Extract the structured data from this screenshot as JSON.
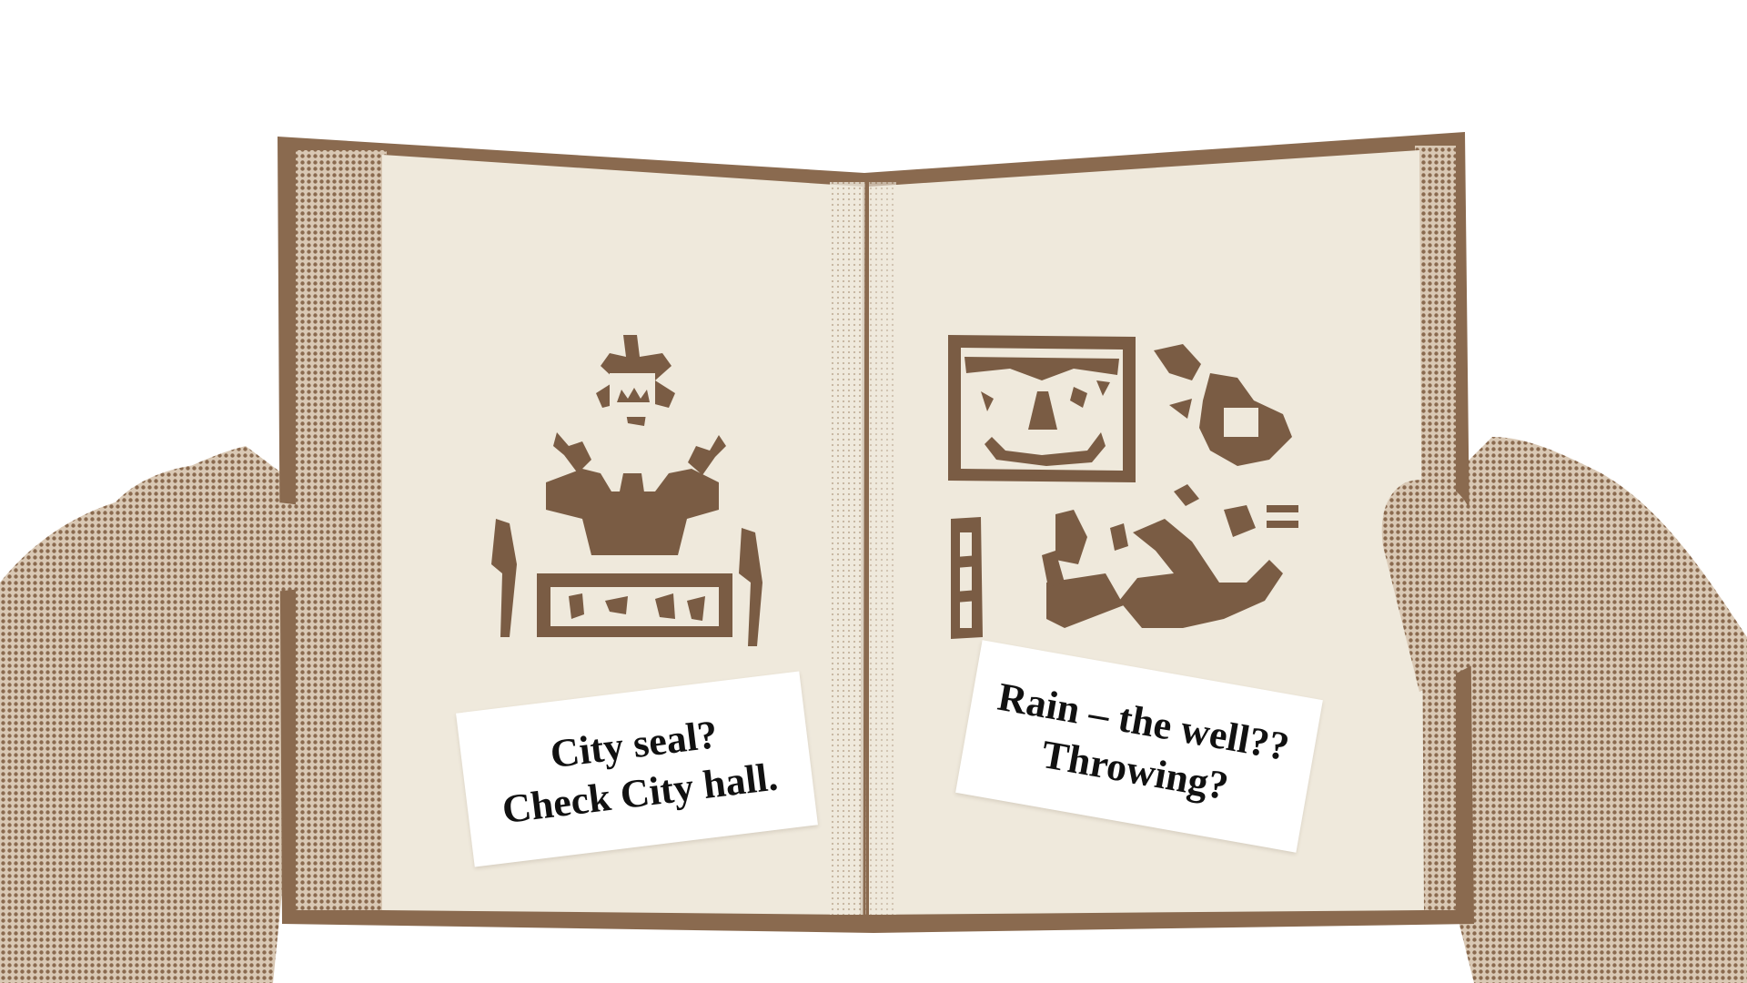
{
  "colors": {
    "ink": "#8a6a4f",
    "ink_dark": "#7a5c44",
    "paper": "#efe9dc",
    "note_bg": "#ffffff",
    "note_text": "#111111"
  },
  "notes": {
    "left": {
      "line1": "City seal?",
      "line2": "Check City hall."
    },
    "right": {
      "line1": "Rain – the well??",
      "line2": "Throwing?"
    }
  },
  "illustrations": {
    "left_page": "city-seal-glyph",
    "right_page": "rain-well-glyph"
  }
}
